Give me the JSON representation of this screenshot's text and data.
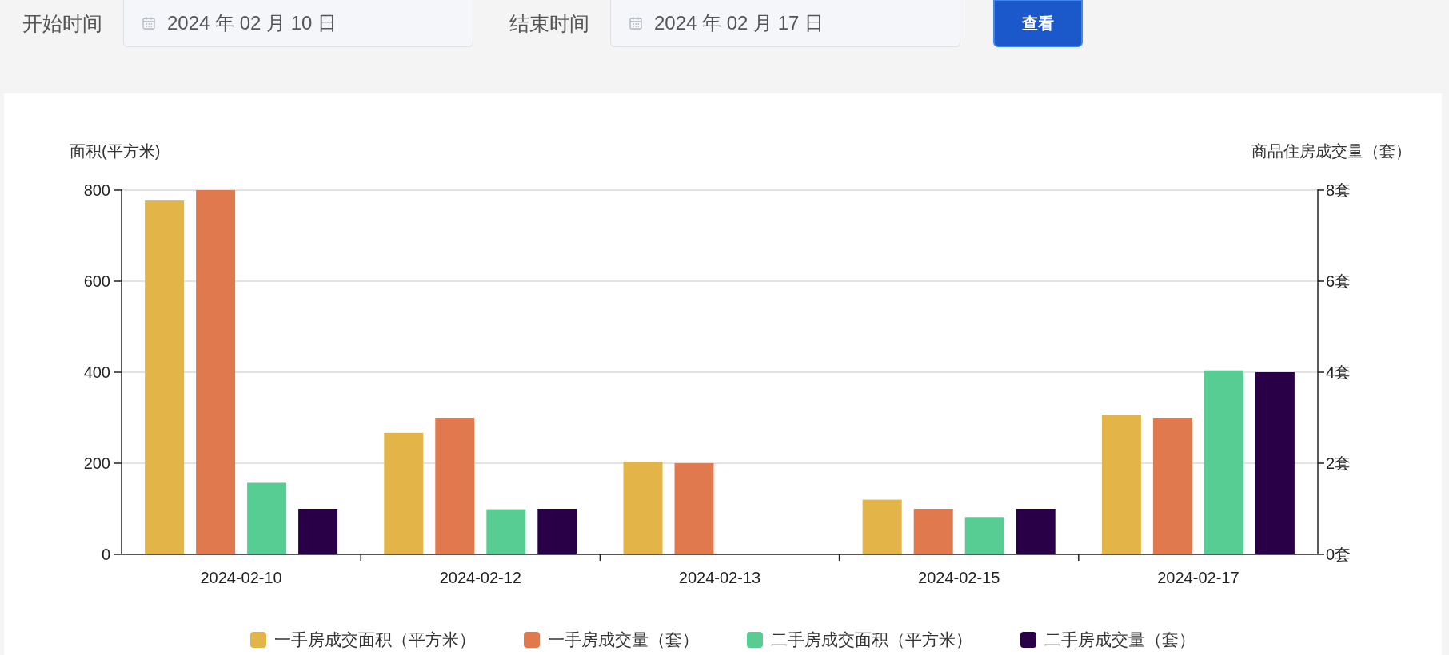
{
  "filters": [
    {
      "label": "开始时间",
      "value": "2024 年 02 月 10 日"
    },
    {
      "label": "结束时间",
      "value": "2024 年 02 月 17 日"
    }
  ],
  "view_button": "查看",
  "chart_data": {
    "type": "bar",
    "ylabel": "面积(平方米)",
    "y2label": "商品住房成交量（套）",
    "categories": [
      "2024-02-10",
      "2024-02-12",
      "2024-02-13",
      "2024-02-15",
      "2024-02-17"
    ],
    "grid": true,
    "ylim": [
      0,
      800
    ],
    "y2lim": [
      0,
      8
    ],
    "yticks": [
      0,
      200,
      400,
      600,
      800
    ],
    "y2ticks": [
      {
        "value": 0,
        "label": "0套"
      },
      {
        "value": 2,
        "label": "2套"
      },
      {
        "value": 4,
        "label": "4套"
      },
      {
        "value": 6,
        "label": "6套"
      },
      {
        "value": 8,
        "label": "8套"
      }
    ],
    "series": [
      {
        "name": "一手房成交面积（平方米）",
        "color": "#e3b548",
        "axis": "y",
        "values": [
          777,
          267,
          203,
          120,
          307
        ]
      },
      {
        "name": "一手房成交量（套）",
        "color": "#e0794e",
        "axis": "y2",
        "values": [
          8,
          3,
          2,
          1,
          3
        ]
      },
      {
        "name": "二手房成交面积（平方米）",
        "color": "#57cd94",
        "axis": "y",
        "values": [
          157,
          99,
          null,
          82,
          404
        ]
      },
      {
        "name": "二手房成交量（套）",
        "color": "#290047",
        "axis": "y2",
        "values": [
          1,
          1,
          null,
          1,
          4
        ]
      }
    ]
  }
}
